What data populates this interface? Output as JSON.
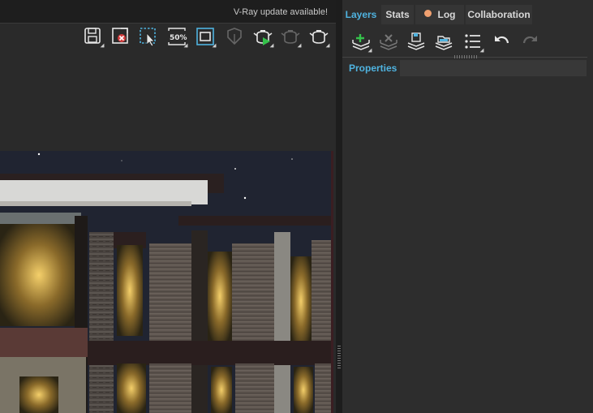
{
  "header": {
    "update_notice": "V-Ray update available!"
  },
  "toolbar": {
    "icons": [
      "save-icon",
      "clear-icon",
      "region-select-icon",
      "zoom-icon",
      "frame-icon",
      "cursor-icon",
      "render-icon",
      "stop-render-icon",
      "teapot-icon"
    ]
  },
  "panel": {
    "tabs": [
      {
        "label": "Layers",
        "active": true
      },
      {
        "label": "Stats",
        "active": false
      },
      {
        "label": "Log",
        "active": false
      },
      {
        "label": "Collaboration",
        "active": false
      }
    ],
    "log_dot_color": "#f0a070",
    "tools": [
      "add-layer-icon",
      "delete-layer-icon",
      "save-layers-icon",
      "load-layers-icon",
      "list-icon",
      "undo-icon",
      "redo-icon"
    ],
    "properties_label": "Properties"
  },
  "colors": {
    "accent": "#4fb3e0",
    "background": "#2b2b2b"
  }
}
